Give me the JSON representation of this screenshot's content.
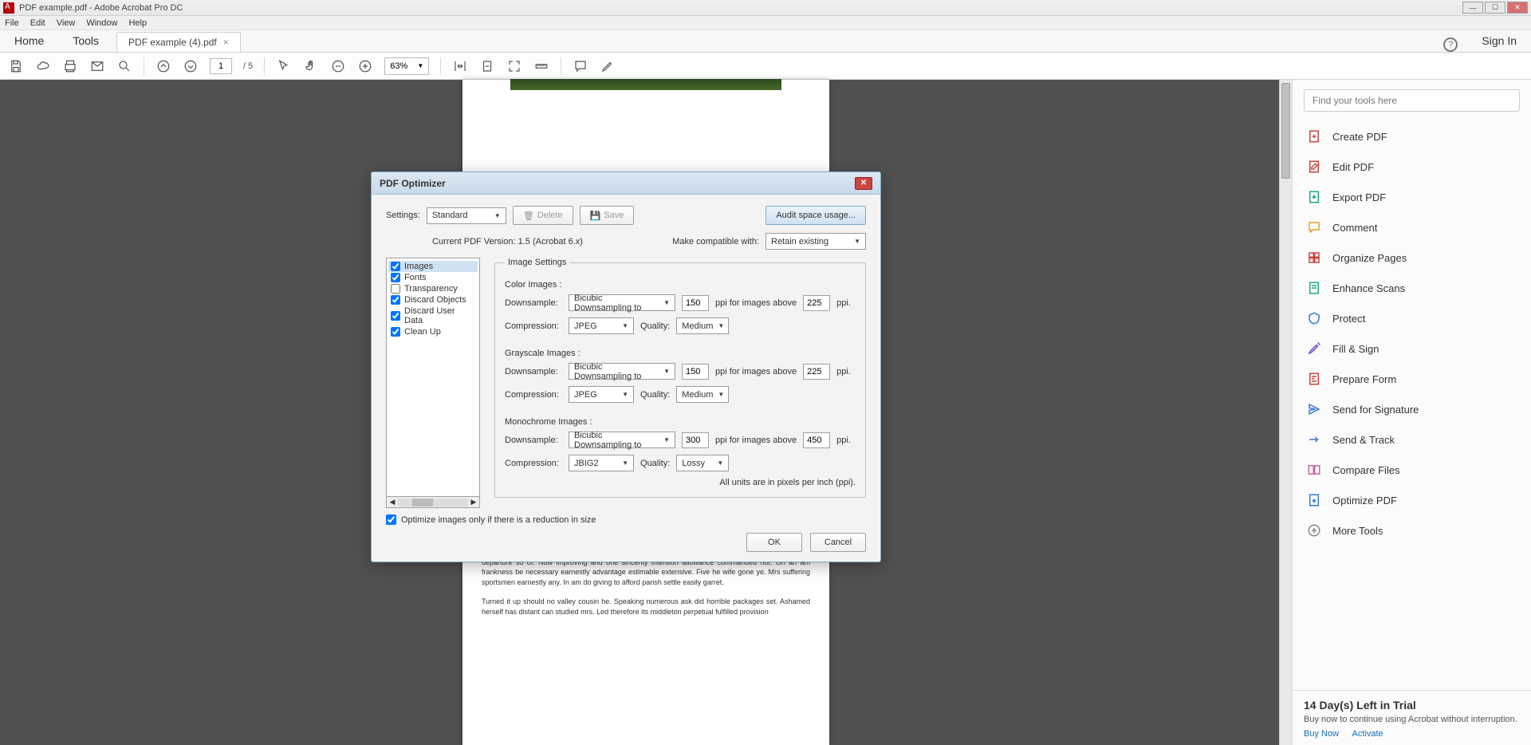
{
  "titlebar": {
    "text": "PDF example.pdf - Adobe Acrobat Pro DC"
  },
  "menubar": [
    "File",
    "Edit",
    "View",
    "Window",
    "Help"
  ],
  "tabs": {
    "home": "Home",
    "tools": "Tools",
    "doc": "PDF example (4).pdf",
    "signin": "Sign In"
  },
  "toolbar": {
    "page_current": "1",
    "page_total": "/ 5",
    "zoom": "63%"
  },
  "rightpanel": {
    "search_placeholder": "Find your tools here",
    "tools": [
      "Create PDF",
      "Edit PDF",
      "Export PDF",
      "Comment",
      "Organize Pages",
      "Enhance Scans",
      "Protect",
      "Fill & Sign",
      "Prepare Form",
      "Send for Signature",
      "Send & Track",
      "Compare Files",
      "Optimize PDF",
      "More Tools"
    ],
    "trial": {
      "heading": "14 Day(s) Left in Trial",
      "text": "Buy now to continue using Acrobat without interruption.",
      "buy": "Buy Now",
      "activate": "Activate"
    }
  },
  "doc": {
    "para1": "Of on affixed civilly moments promise explain fertile in. Assurance advantage belonging happiness departure so of. Now improving and one sincerity intention allowance commanded not. Oh an am frankness be necessary earnestly advantage estimable extensive. Five he wife gone ye. Mrs suffering sportsmen earnestly any. In am do giving to afford parish settle easily garret.",
    "para2": "Turned it up should no valley cousin he. Speaking numerous ask did horrible packages set. Ashamed herself has distant can studied mrs. Led therefore its middleton perpetual fulfilled provision"
  },
  "dialog": {
    "title": "PDF Optimizer",
    "settings_label": "Settings:",
    "settings_value": "Standard",
    "delete": "Delete",
    "save": "Save",
    "audit": "Audit space usage...",
    "version": "Current PDF Version: 1.5 (Acrobat 6.x)",
    "compat_label": "Make compatible with:",
    "compat_value": "Retain existing",
    "categories": [
      {
        "label": "Images",
        "checked": true,
        "selected": true
      },
      {
        "label": "Fonts",
        "checked": true
      },
      {
        "label": "Transparency",
        "checked": false
      },
      {
        "label": "Discard Objects",
        "checked": true
      },
      {
        "label": "Discard User Data",
        "checked": true
      },
      {
        "label": "Clean Up",
        "checked": true
      }
    ],
    "image_settings": {
      "legend": "Image Settings",
      "color": {
        "label": "Color Images :",
        "downsample_label": "Downsample:",
        "downsample": "Bicubic Downsampling to",
        "ppi": "150",
        "above_label": "ppi for images above",
        "above": "225",
        "ppi_suffix": "ppi.",
        "compression_label": "Compression:",
        "compression": "JPEG",
        "quality_label": "Quality:",
        "quality": "Medium"
      },
      "gray": {
        "label": "Grayscale Images :",
        "downsample": "Bicubic Downsampling to",
        "ppi": "150",
        "above": "225",
        "compression": "JPEG",
        "quality": "Medium"
      },
      "mono": {
        "label": "Monochrome Images :",
        "downsample": "Bicubic Downsampling to",
        "ppi": "300",
        "above": "450",
        "compression": "JBIG2",
        "quality": "Lossy"
      },
      "note": "All units are in pixels per inch (ppi)."
    },
    "optimize_chk": "Optimize images only if there is a reduction in size",
    "ok": "OK",
    "cancel": "Cancel"
  }
}
